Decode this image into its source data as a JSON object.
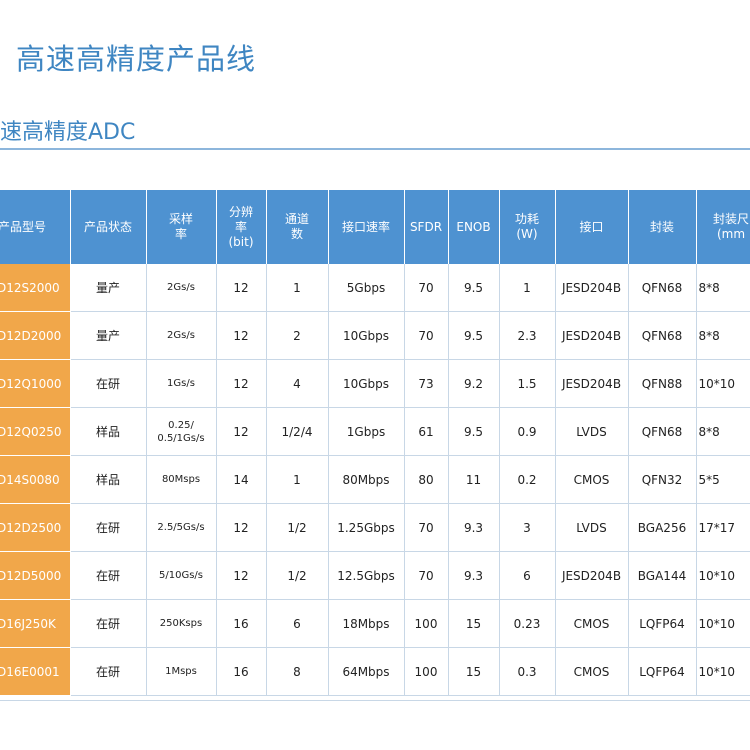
{
  "page_title": "高速高精度产品线",
  "section_title": "速高精度ADC",
  "table": {
    "headers": [
      "产品型号",
      "产品状态",
      "采样\n率",
      "分辨\n率\n(bit)",
      "通道\n数",
      "接口速率",
      "SFDR",
      "ENOB",
      "功耗\n(W)",
      "接口",
      "封装",
      "封装尺\n(mm"
    ],
    "rows": [
      [
        "D12S2000",
        "量产",
        "2Gs/s",
        "12",
        "1",
        "5Gbps",
        "70",
        "9.5",
        "1",
        "JESD204B",
        "QFN68",
        "8*8"
      ],
      [
        "D12D2000",
        "量产",
        "2Gs/s",
        "12",
        "2",
        "10Gbps",
        "70",
        "9.5",
        "2.3",
        "JESD204B",
        "QFN68",
        "8*8"
      ],
      [
        "D12Q1000",
        "在研",
        "1Gs/s",
        "12",
        "4",
        "10Gbps",
        "73",
        "9.2",
        "1.5",
        "JESD204B",
        "QFN88",
        "10*10"
      ],
      [
        "D12Q0250",
        "样品",
        "0.25/\n0.5/1Gs/s",
        "12",
        "1/2/4",
        "1Gbps",
        "61",
        "9.5",
        "0.9",
        "LVDS",
        "QFN68",
        "8*8"
      ],
      [
        "D14S0080",
        "样品",
        "80Msps",
        "14",
        "1",
        "80Mbps",
        "80",
        "11",
        "0.2",
        "CMOS",
        "QFN32",
        "5*5"
      ],
      [
        "D12D2500",
        "在研",
        "2.5/5Gs/s",
        "12",
        "1/2",
        "1.25Gbps",
        "70",
        "9.3",
        "3",
        "LVDS",
        "BGA256",
        "17*17"
      ],
      [
        "D12D5000",
        "在研",
        "5/10Gs/s",
        "12",
        "1/2",
        "12.5Gbps",
        "70",
        "9.3",
        "6",
        "JESD204B",
        "BGA144",
        "10*10"
      ],
      [
        "D16J250K",
        "在研",
        "250Ksps",
        "16",
        "6",
        "18Mbps",
        "100",
        "15",
        "0.23",
        "CMOS",
        "LQFP64",
        "10*10"
      ],
      [
        "D16E0001",
        "在研",
        "1Msps",
        "16",
        "8",
        "64Mbps",
        "100",
        "15",
        "0.3",
        "CMOS",
        "LQFP64",
        "10*10"
      ]
    ]
  },
  "colors": {
    "accent": "#3f86c2",
    "header_bg": "#4e92d1",
    "model_bg": "#f1a74a"
  }
}
